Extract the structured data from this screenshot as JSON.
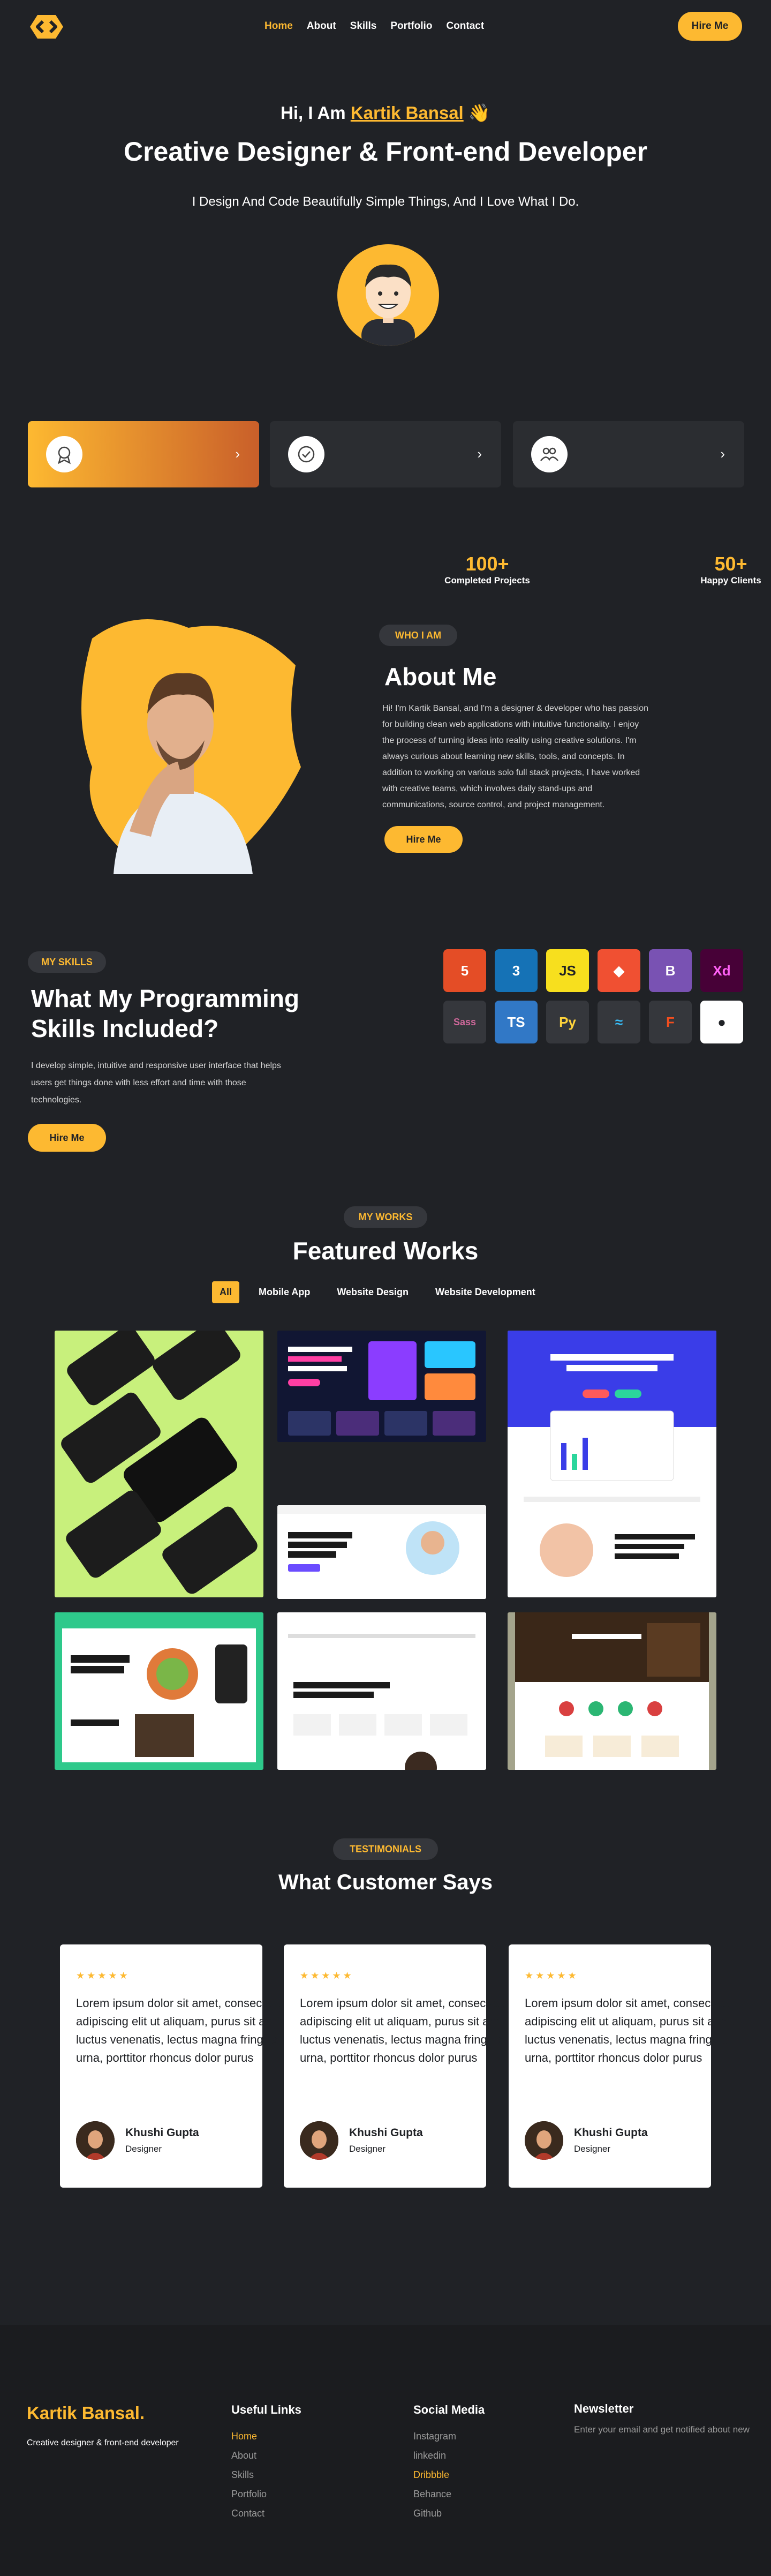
{
  "colors": {
    "background": "#202226",
    "accent": "#fdb931",
    "card": "#2b2d31"
  },
  "nav": {
    "items": [
      "Home",
      "About",
      "Skills",
      "Portfolio",
      "Contact"
    ],
    "hire_label": "Hire Me"
  },
  "hero": {
    "greeting": "Hi, I Am",
    "name": "Kartik Bansal",
    "wave": "👋",
    "title": "Creative Designer & Front-end Developer",
    "subtitle": "I Design And Code Beautifully Simple Things, And I Love What I Do."
  },
  "services": [
    {
      "icon": "badge-icon",
      "arrow": "›"
    },
    {
      "icon": "check-badge-icon",
      "arrow": "›"
    },
    {
      "icon": "team-icon",
      "arrow": "›"
    }
  ],
  "stats": [
    {
      "num": "100+",
      "label": "Completed Projects"
    },
    {
      "num": "50+",
      "label": "Happy Clients"
    }
  ],
  "about": {
    "pill": "WHO I AM",
    "title": "About Me",
    "text": "Hi! I'm Kartik Bansal, and I'm a designer & developer who has passion for building clean web applications with intuitive functionality. I enjoy the process of turning ideas into reality using creative solutions. I'm always curious about learning new skills, tools, and concepts. In addition to working on various solo full stack projects, I have worked with creative teams, which involves daily stand-ups and communications, source control, and project management.",
    "button": "Hire Me"
  },
  "skills": {
    "pill": "MY SKILLS",
    "title": "What My Programming Skills Included?",
    "text": "I develop simple, intuitive and responsive user interface that helps users get things done with less effort and time with those technologies.",
    "button": "Hire Me",
    "icons": [
      {
        "name": "html5-icon",
        "label": "5",
        "bg": "#e44d26",
        "fg": "#ffffff"
      },
      {
        "name": "css3-icon",
        "label": "3",
        "bg": "#1572b6",
        "fg": "#ffffff"
      },
      {
        "name": "javascript-icon",
        "label": "JS",
        "bg": "#f7df1e",
        "fg": "#202226"
      },
      {
        "name": "git-icon",
        "label": "◆",
        "bg": "#f05032",
        "fg": "#ffffff"
      },
      {
        "name": "bootstrap-icon",
        "label": "B",
        "bg": "#7952b3",
        "fg": "#ffffff"
      },
      {
        "name": "adobe-xd-icon",
        "label": "Xd",
        "bg": "#470137",
        "fg": "#ff61f6"
      },
      {
        "name": "sass-icon",
        "label": "Sass",
        "bg": "#35373c",
        "fg": "#cd6799"
      },
      {
        "name": "typescript-icon",
        "label": "TS",
        "bg": "#3178c6",
        "fg": "#ffffff"
      },
      {
        "name": "python-icon",
        "label": "Py",
        "bg": "#35373c",
        "fg": "#ffd43b"
      },
      {
        "name": "tailwind-icon",
        "label": "≈",
        "bg": "#35373c",
        "fg": "#38bdf8"
      },
      {
        "name": "figma-icon",
        "label": "F",
        "bg": "#35373c",
        "fg": "#f24e1e"
      },
      {
        "name": "github-icon",
        "label": "●",
        "bg": "#ffffff",
        "fg": "#202226"
      }
    ]
  },
  "works": {
    "pill": "MY WORKS",
    "title": "Featured Works",
    "filters": [
      "All",
      "Mobile App",
      "Website Design",
      "Website Development"
    ]
  },
  "testimonials": {
    "pill": "TESTIMONIALS",
    "title": "What Customer Says",
    "cards": [
      {
        "stars": "★★★★★",
        "quote": "Lorem ipsum dolor sit amet, consectetur adipiscing elit ut aliquam, purus sit amet luctus venenatis, lectus magna fringilla urna, porttitor rhoncus dolor purus",
        "name": "Khushi Gupta",
        "role": "Designer"
      },
      {
        "stars": "★★★★★",
        "quote": "Lorem ipsum dolor sit amet, consectetur adipiscing elit ut aliquam, purus sit amet luctus venenatis, lectus magna fringilla urna, porttitor rhoncus dolor purus",
        "name": "Khushi Gupta",
        "role": "Designer"
      },
      {
        "stars": "★★★★★",
        "quote": "Lorem ipsum dolor sit amet, consectetur adipiscing elit ut aliquam, purus sit amet luctus venenatis, lectus magna fringilla urna, porttitor rhoncus dolor purus",
        "name": "Khushi Gupta",
        "role": "Designer"
      }
    ]
  },
  "footer": {
    "brand": "Kartik Bansal.",
    "tagline": "Creative designer & front-end developer",
    "useful_title": "Useful Links",
    "useful": [
      "Home",
      "About",
      "Skills",
      "Portfolio",
      "Contact"
    ],
    "social_title": "Social Media",
    "social": [
      "Instagram",
      "linkedin",
      "Dribbble",
      "Behance",
      "Github"
    ],
    "newsletter_title": "Newsletter",
    "newsletter_text": "Enter your email and get notified about new"
  }
}
